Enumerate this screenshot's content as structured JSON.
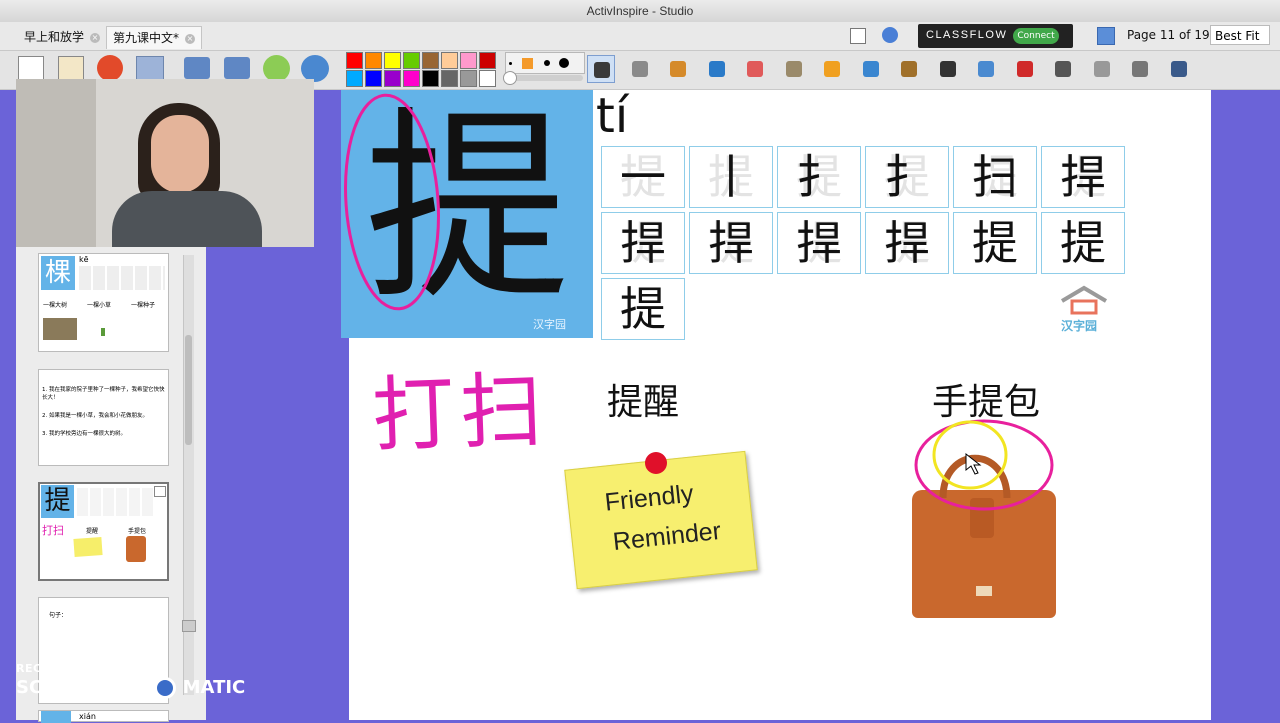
{
  "window": {
    "title": "ActivInspire - Studio"
  },
  "tabs": [
    {
      "label": "早上和放学"
    },
    {
      "label": "第九课中文*"
    }
  ],
  "classflow": {
    "brand": "CLASSFLOW",
    "connect_label": "Connect"
  },
  "page_indicator": "Page 11 of 19",
  "zoom": "Best Fit",
  "palette": {
    "top": [
      "#ff0000",
      "#ff8800",
      "#ffff00",
      "#66cc00",
      "#996633",
      "#ffcc99",
      "#ff99cc",
      "#cc0000"
    ],
    "bottom": [
      "#00aaff",
      "#0000ff",
      "#9900cc",
      "#ff00cc",
      "#000000",
      "#666666",
      "#999999",
      "#ffffff"
    ]
  },
  "tools": [
    "select-icon",
    "tools-icon",
    "pen-icon",
    "highlighter-icon",
    "eraser-icon",
    "fill-icon",
    "shapes-icon",
    "connector-icon",
    "media-icon",
    "text-icon",
    "flask-icon",
    "reset-icon",
    "undo-icon",
    "redo-icon",
    "page-icon",
    "edit-icon"
  ],
  "thumbnails": [
    {
      "char": "棵",
      "pinyin": "kē",
      "phrases": [
        "一棵大树",
        "一棵小草",
        "一棵种子"
      ]
    },
    {
      "lines": [
        "1. 我在我家的院子里种了一棵种子，我希望它快快长大！",
        "2. 如果我是一棵小草，我会和小花做朋友。",
        "3. 我的学校旁边有一棵很大的树。"
      ]
    },
    {
      "char": "提",
      "phrases": [
        "打扫",
        "提醒",
        "手提包"
      ]
    },
    {
      "label": "句子："
    },
    {
      "pinyin": "xián"
    }
  ],
  "slide": {
    "big_char": "提",
    "pinyin": "tí",
    "stroke_order": [
      "一",
      "丨",
      "扌",
      "扌",
      "扫",
      "捍",
      "捍",
      "捍",
      "捍",
      "捍",
      "提",
      "提",
      "提"
    ],
    "logo_text": "汉字园",
    "handwritten": "打扫",
    "word1": "提醒",
    "word2": "手提包",
    "note_line1": "Friendly",
    "note_line2": "Reminder"
  },
  "watermark": {
    "line1": "RECORDED WITH",
    "line2a": "SCREENCAST",
    "line2b": "MATIC"
  }
}
